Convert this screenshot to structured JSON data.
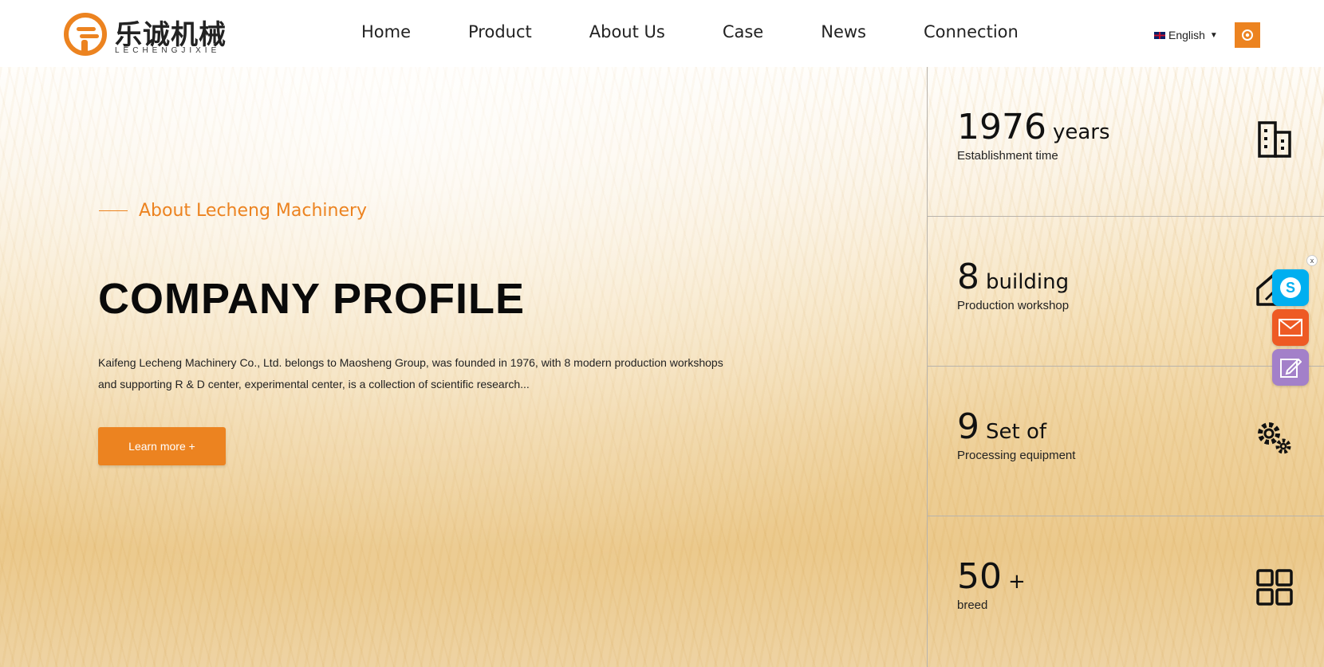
{
  "header": {
    "logo": {
      "cn": "乐诚机械",
      "en": "LECHENGJIXIE"
    },
    "nav": [
      "Home",
      "Product",
      "About Us",
      "Case",
      "News",
      "Connection"
    ],
    "language": "English"
  },
  "hero": {
    "section_label": "About Lecheng Machinery",
    "title": "COMPANY PROFILE",
    "description_line1": "Kaifeng Lecheng Machinery Co., Ltd. belongs to Maosheng Group, was founded in 1976, with 8 modern production workshops",
    "description_line2": "and supporting R & D center, experimental center, is a collection of scientific research...",
    "button_label": "Learn more +"
  },
  "stats": [
    {
      "value": "1976",
      "unit": "years",
      "label": "Establishment time",
      "icon": "building-icon"
    },
    {
      "value": "8",
      "unit": "building",
      "label": "Production workshop",
      "icon": "workshop-icon"
    },
    {
      "value": "9",
      "unit": "Set of",
      "label": "Processing equipment",
      "icon": "gears-icon"
    },
    {
      "value": "50",
      "unit": "+",
      "label": "breed",
      "icon": "grid-icon"
    }
  ],
  "float_contact": {
    "close": "x",
    "items": [
      "skype-icon",
      "email-icon",
      "edit-icon"
    ]
  },
  "colors": {
    "accent": "#ec8320",
    "skype": "#00aff0",
    "email": "#ee5a24",
    "edit": "#a380c9"
  }
}
